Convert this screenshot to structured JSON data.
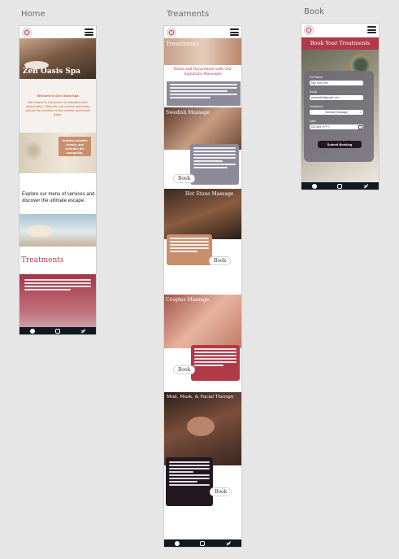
{
  "frames": {
    "home_label": "Home",
    "treatments_label": "Treaments",
    "book_label": "Book"
  },
  "home": {
    "hero_title": "Zen Oasis Spa",
    "welcome_heading": "Welcome to Zen Oasis Spa",
    "welcome_text": "We believe in the power of relaxation and rejuvenation. Step into our serene sanctuary and let the tensions of the outside world melt away.",
    "banner_text": "Unwind, breathe deeply, and embrace the tranquility.",
    "explore_text": "Explore our menu of services and discover the ultimate escape.",
    "treatments_heading": "Treatments"
  },
  "treatments": {
    "header_title": "Treatments",
    "intro_title": "Relax and Rejuvenate with Our Signature Massages",
    "items": [
      {
        "title": "Swedish Massage",
        "book": "Book"
      },
      {
        "title": "Hot Stone Massage",
        "book": "Book"
      },
      {
        "title": "Couples Massage",
        "book": "Book"
      },
      {
        "title": "Mud, Mask, & Facial Therapy",
        "book": "Book"
      }
    ]
  },
  "book": {
    "title": "Book Your Treatments",
    "full_name_label": "Full Name:",
    "full_name_value": "Mei Soon Hui",
    "email_label": "Email:",
    "email_value": "janesmith@gmail.com",
    "treatment_label": "Treatment:",
    "treatment_value": "Swedish Massage",
    "date_label": "Date:",
    "date_placeholder": "DD-MM-YYYY",
    "submit_label": "Submit Booking"
  },
  "colors": {
    "accent": "#b03a48",
    "dark": "#101820",
    "orange": "#c8602e"
  }
}
